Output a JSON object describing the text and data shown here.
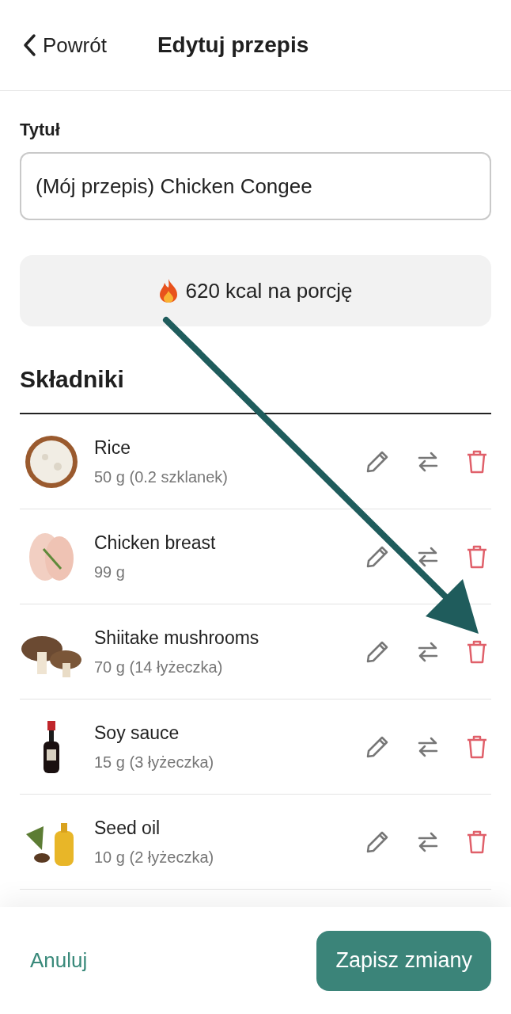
{
  "header": {
    "back_label": "Powrót",
    "title": "Edytuj przepis"
  },
  "title_field": {
    "label": "Tytuł",
    "value": "(Mój przepis) Chicken Congee"
  },
  "calories": {
    "text": "620 kcal na porcję"
  },
  "ingredients": {
    "heading": "Składniki",
    "items": [
      {
        "name": "Rice",
        "amount": "50 g (0.2 szklanek)",
        "kind": "picture"
      },
      {
        "name": "Chicken breast",
        "amount": "99 g",
        "kind": "picture"
      },
      {
        "name": "Shiitake mushrooms",
        "amount": "70 g (14 łyżeczka)",
        "kind": "picture"
      },
      {
        "name": "Soy sauce",
        "amount": "15 g (3 łyżeczka)",
        "kind": "picture"
      },
      {
        "name": "Seed oil",
        "amount": "10 g (2 łyżeczka)",
        "kind": "picture"
      }
    ]
  },
  "footer": {
    "cancel": "Anuluj",
    "save": "Zapisz zmiany"
  }
}
